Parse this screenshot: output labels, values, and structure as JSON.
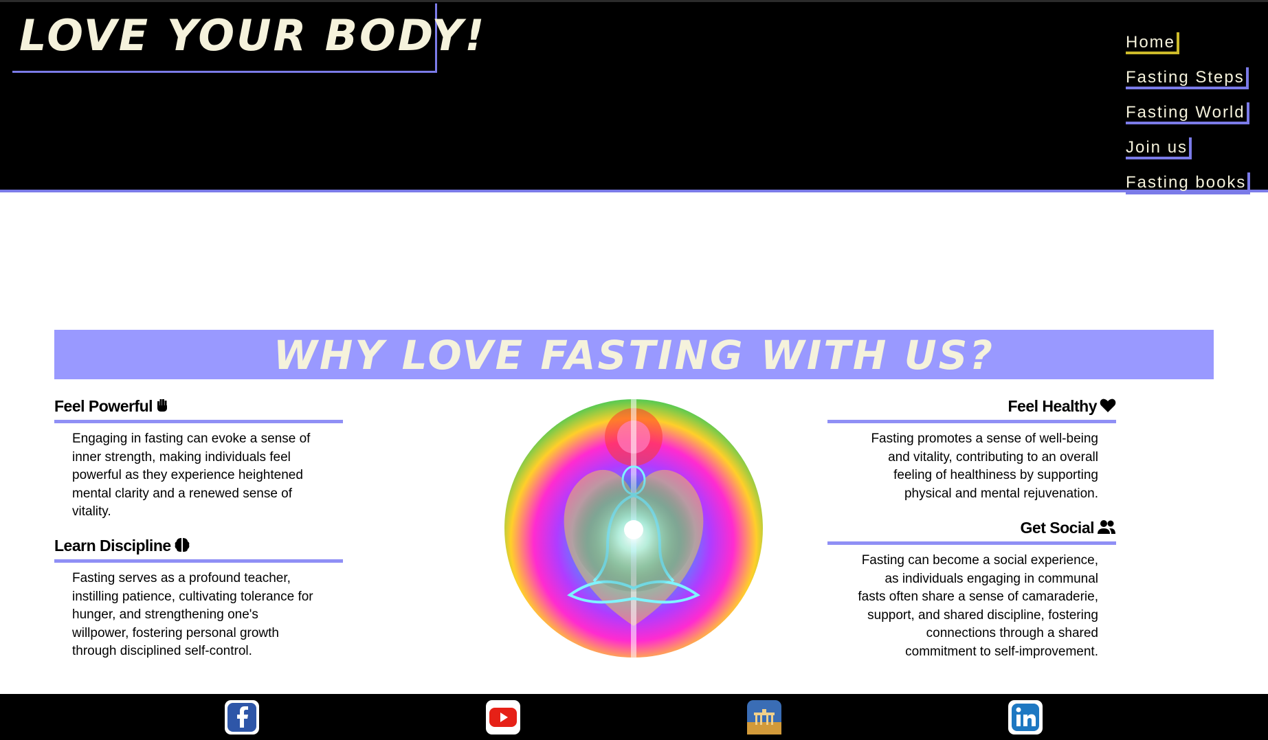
{
  "header": {
    "logo": "LOVE YOUR BODY!",
    "nav": [
      {
        "label": "Home",
        "active": true
      },
      {
        "label": "Fasting Steps",
        "active": false
      },
      {
        "label": "Fasting World",
        "active": false
      },
      {
        "label": "Join us",
        "active": false
      },
      {
        "label": "Fasting books",
        "active": false
      }
    ]
  },
  "section": {
    "title": "WHY LOVE FASTING WITH US?",
    "features": [
      {
        "heading": "Feel Powerful",
        "icon": "raised-fist-icon",
        "text": "Engaging in fasting can evoke a sense of inner strength, making individuals feel powerful as they experience heightened mental clarity and a renewed sense of vitality."
      },
      {
        "heading": "Learn Discipline",
        "icon": "brain-icon",
        "text": "Fasting serves as a profound teacher, instilling patience, cultivating tolerance for hunger, and strengthening one's willpower, fostering personal growth through disciplined self-control."
      },
      {
        "heading": "Feel Healthy",
        "icon": "heart-icon",
        "text": "Fasting promotes a sense of well-being and vitality, contributing to an overall feeling of healthiness by supporting physical and mental rejuvenation."
      },
      {
        "heading": "Get Social",
        "icon": "user-group-icon",
        "text": "Fasting can become a social experience, as individuals engaging in communal fasts often share a sense of camaraderie, support, and shared discipline, fostering connections through a shared commitment to self-improvement."
      }
    ],
    "image_icon": "meditating-aura-image"
  },
  "footer": {
    "social": [
      {
        "icon": "facebook-icon"
      },
      {
        "icon": "youtube-icon"
      },
      {
        "icon": "brandenburg-gate-icon"
      },
      {
        "icon": "linkedin-icon"
      }
    ]
  },
  "colors": {
    "accent": "#7b7be8",
    "banner": "#9999ff",
    "cream": "#f5f2dc",
    "active_underline": "#cdbb2a"
  }
}
